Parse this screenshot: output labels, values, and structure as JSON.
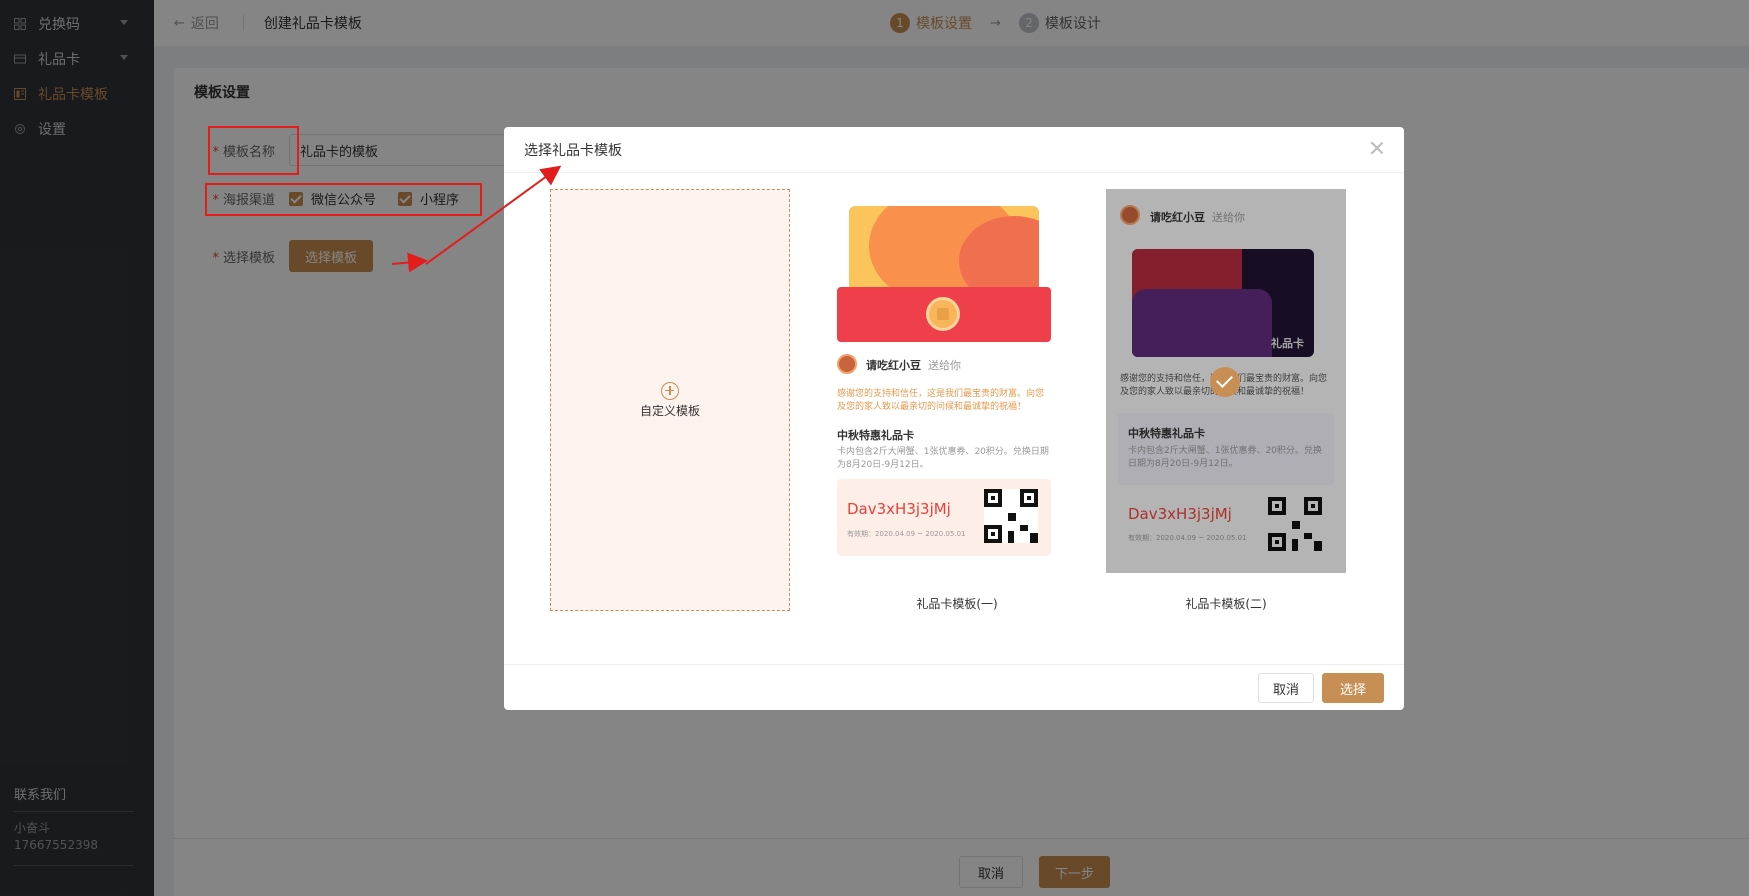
{
  "sidebar": {
    "items": [
      {
        "label": "兑换码",
        "icon": "grid-icon",
        "has_arrow": true
      },
      {
        "label": "礼品卡",
        "icon": "card-icon",
        "has_arrow": true
      },
      {
        "label": "礼品卡模板",
        "icon": "template-icon",
        "active": true
      },
      {
        "label": "设置",
        "icon": "gear-icon"
      }
    ],
    "contact": {
      "title": "联系我们",
      "name": "小奋斗",
      "phone": "17667552398"
    }
  },
  "header": {
    "back_label": "返回",
    "title": "创建礼品卡模板",
    "steps": [
      {
        "num": "1",
        "label": "模板设置",
        "active": true
      },
      {
        "num": "2",
        "label": "模板设计",
        "active": false
      }
    ]
  },
  "form": {
    "section_title": "模板设置",
    "name_label": "模板名称",
    "name_value": "礼品卡的模板",
    "channel_label": "海报渠道",
    "channels": [
      "微信公众号",
      "小程序"
    ],
    "select_label": "选择模板",
    "select_button": "选择模板"
  },
  "footer": {
    "cancel": "取消",
    "next": "下一步"
  },
  "modal": {
    "title": "选择礼品卡模板",
    "custom_label": "自定义模板",
    "templates": [
      {
        "name": "礼品卡模板(一)",
        "from": "请吃红小豆",
        "send": "送给你",
        "message": "感谢您的支持和信任，这是我们最宝贵的财富。向您及您的家人致以最亲切的问候和最诚挚的祝福！",
        "card_title": "中秋特惠礼品卡",
        "card_desc": "卡内包含2斤大闸蟹、1张优惠券、20积分。兑换日期为8月20日-9月12日。",
        "code": "Dav3xH3j3jMj",
        "valid": "有效期：2020.04.09 ~ 2020.05.01"
      },
      {
        "name": "礼品卡模板(二)",
        "from": "请吃红小豆",
        "send": "送给你",
        "card_label": "礼品卡",
        "message": "感谢您的支持和信任，这是我们最宝贵的财富。向您及您的家人致以最亲切的问候和最诚挚的祝福！",
        "card_title": "中秋特惠礼品卡",
        "card_desc": "卡内包含2斤大闸蟹、1张优惠券、20积分。兑换日期为8月20日-9月12日。",
        "code": "Dav3xH3j3jMj",
        "valid": "有效期：2020.04.09 ~ 2020.05.01",
        "selected": true
      }
    ],
    "cancel": "取消",
    "ok": "选择"
  },
  "colors": {
    "accent": "#c88f54",
    "sidebar_bg": "#2f3338",
    "annotation": "#e31c1c",
    "code_red": "#e6423a"
  }
}
